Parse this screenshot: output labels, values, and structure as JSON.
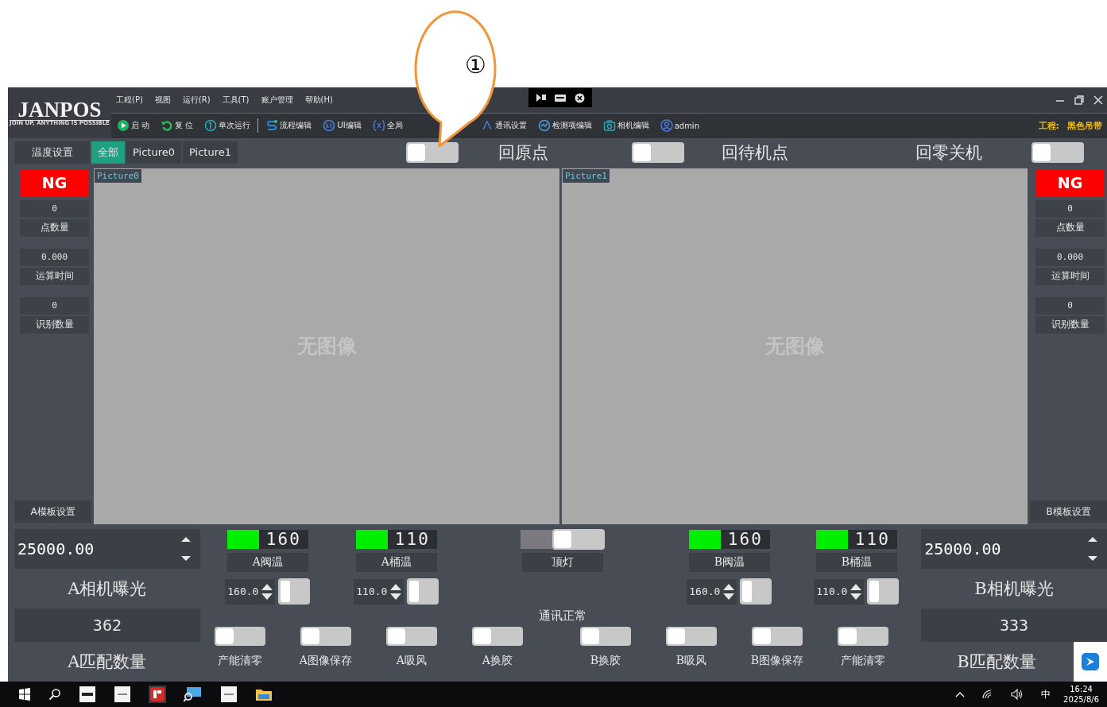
{
  "annotation": {
    "marker": "①"
  },
  "titlebar": {
    "logo": "JANPOS",
    "tagline": "JOIN UP, ANYTHING IS POSSIBLE",
    "menu": [
      "工程(P)",
      "视图",
      "运行(R)",
      "工具(T)",
      "账户管理",
      "帮助(H)"
    ]
  },
  "toolbar": {
    "run_group": [
      {
        "kind": "play",
        "label": "启 动"
      },
      {
        "kind": "reset",
        "label": "复 位"
      },
      {
        "kind": "single",
        "label": "单次运行"
      }
    ],
    "edit_group": [
      {
        "kind": "flow",
        "label": "流程编辑"
      },
      {
        "kind": "ui",
        "label": "UI编辑"
      },
      {
        "kind": "global",
        "label": "全局"
      },
      {
        "kind": "comm",
        "label": "通讯设置"
      },
      {
        "kind": "inspect",
        "label": "检测项编辑"
      },
      {
        "kind": "camera",
        "label": "相机编辑"
      },
      {
        "kind": "user",
        "label": "admin"
      }
    ],
    "project": {
      "label": "工程:",
      "value": "黑色吊带"
    }
  },
  "controls": {
    "side_button": "温度设置",
    "tabs": [
      {
        "label": "全部",
        "selected": true
      },
      {
        "label": "Picture0",
        "selected": false
      },
      {
        "label": "Picture1",
        "selected": false
      }
    ],
    "items": [
      {
        "kind": "switch",
        "on": false
      },
      {
        "kind": "label",
        "text": "回原点"
      },
      {
        "kind": "switch",
        "on": false
      },
      {
        "kind": "label",
        "text": "回待机点"
      },
      {
        "kind": "label",
        "text": "回零关机"
      },
      {
        "kind": "switch",
        "on": false
      }
    ]
  },
  "left_panel": {
    "status": "NG",
    "pass": false,
    "stats": [
      {
        "value": "0",
        "label": "点数量"
      },
      {
        "value": "0.000",
        "label": "运算时间"
      },
      {
        "value": "0",
        "label": "识别数量"
      }
    ],
    "template_button": "A模板设置"
  },
  "views": [
    {
      "tag": "Picture0",
      "message": "无图像"
    },
    {
      "tag": "Picture1",
      "message": "无图像"
    }
  ],
  "right_panel": {
    "status": "NG",
    "pass": false,
    "stats": [
      {
        "value": "0",
        "label": "点数量"
      },
      {
        "value": "0.000",
        "label": "运算时间"
      },
      {
        "value": "0",
        "label": "识别数量"
      }
    ],
    "template_button": "B模板设置"
  },
  "sides": [
    {
      "exposure": "25000.00",
      "exposure_label": "A相机曝光",
      "count": "362",
      "count_label": "A匹配数量"
    },
    {
      "exposure": "25000.00",
      "exposure_label": "B相机曝光",
      "count": "333",
      "count_label": "B匹配数量"
    }
  ],
  "heaters": [
    {
      "kind": "heater",
      "lit": true,
      "display": "160",
      "label": "A阀温",
      "setpoint": "160.0",
      "switch_on": false
    },
    {
      "kind": "heater",
      "lit": true,
      "display": "110",
      "label": "A桶温",
      "setpoint": "110.0",
      "switch_on": false
    },
    {
      "kind": "lamp",
      "lit": false,
      "label": "顶灯",
      "switch_on": false
    },
    {
      "kind": "heater",
      "lit": true,
      "display": "160",
      "label": "B阀温",
      "setpoint": "160.0",
      "switch_on": false
    },
    {
      "kind": "heater",
      "lit": true,
      "display": "110",
      "label": "B桶温",
      "setpoint": "110.0",
      "switch_on": false
    }
  ],
  "comm_status": "通讯正常",
  "actions": [
    {
      "label": "产能清零",
      "on": false
    },
    {
      "label": "A图像保存",
      "on": false
    },
    {
      "label": "A吸风",
      "on": false
    },
    {
      "label": "A换胶",
      "on": false
    },
    {
      "label": "B换胶",
      "on": false
    },
    {
      "label": "B吸风",
      "on": false
    },
    {
      "label": "B图像保存",
      "on": false
    },
    {
      "label": "产能清零",
      "on": false
    }
  ],
  "taskbar": {
    "ime": "中",
    "time": "16:24",
    "date": "2025/8/6"
  }
}
